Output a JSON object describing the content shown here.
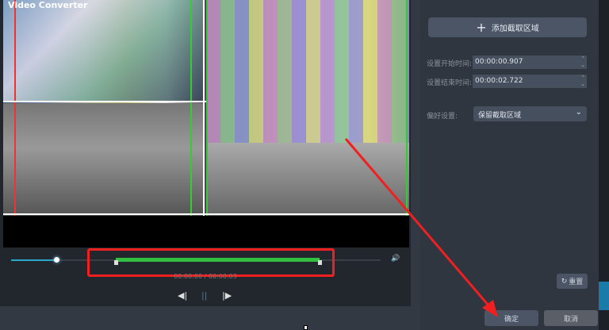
{
  "window": {
    "title": "Video Converter"
  },
  "player": {
    "time": "00:00:00 / 00:00:03",
    "prev_icon": "◀|",
    "pause_icon": "||",
    "next_icon": "|▶",
    "volume_icon": "🔊",
    "progress": 0.13,
    "clip_start": 0.28,
    "clip_end": 0.78
  },
  "panel": {
    "add_region": "添加截取区域",
    "start_label": "设置开始时间:",
    "start_value": "00:00:00.907",
    "end_label": "设置结束时间:",
    "end_value": "00:00:02.722",
    "pref_label": "偏好设置:",
    "pref_value": "保留截取区域",
    "reset": "重置",
    "ok": "确定",
    "cancel": "取消"
  }
}
